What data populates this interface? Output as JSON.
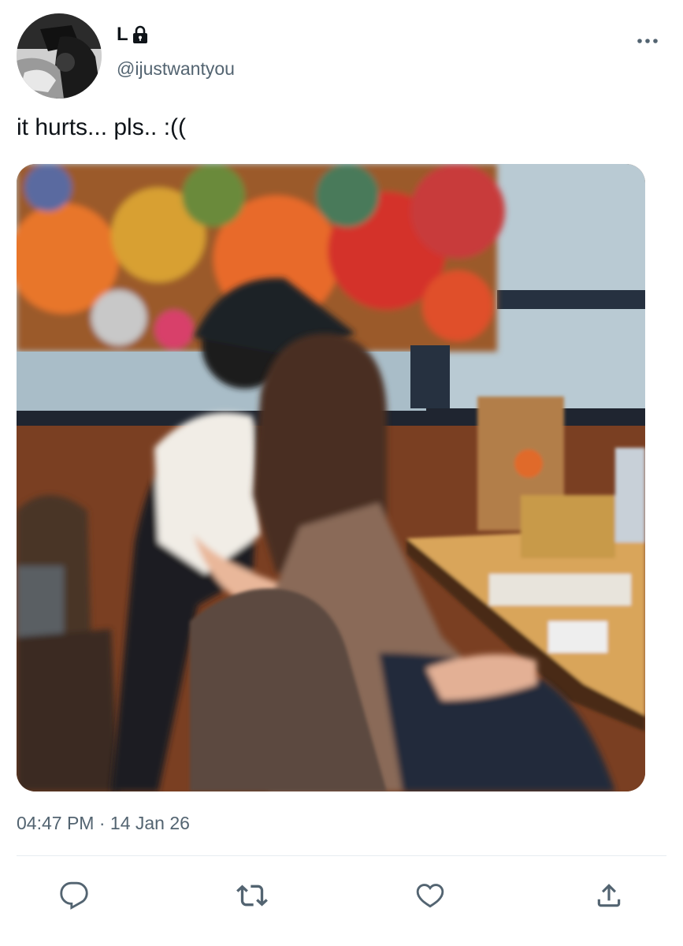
{
  "tweet": {
    "author_name": "L",
    "author_handle": "@ijustwantyou",
    "text": "it hurts... pls.. :((",
    "time": "04:47 PM",
    "separator": "·",
    "date": "14 Jan 26"
  },
  "icons": {
    "lock": "lock-icon",
    "more": "more-options-icon",
    "reply": "reply-icon",
    "retweet": "retweet-icon",
    "like": "like-icon",
    "share": "share-icon"
  },
  "colors": {
    "text": "#0f1419",
    "secondary": "#536471",
    "divider": "#e6ecf0"
  }
}
